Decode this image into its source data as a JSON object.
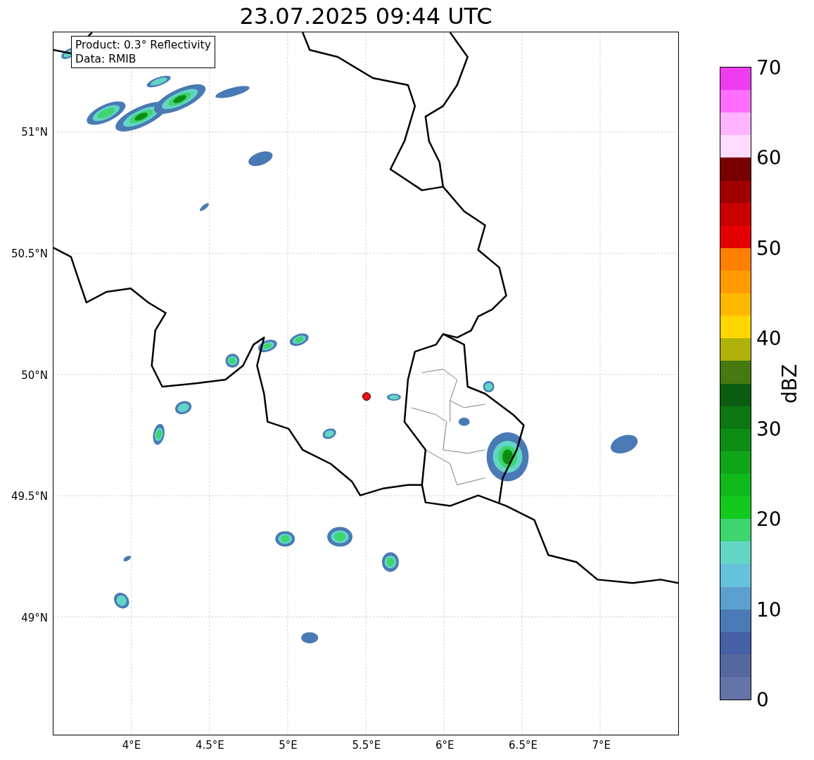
{
  "title": "23.07.2025 09:44 UTC",
  "legend": {
    "lines": [
      "Product: 0.3° Reflectivity",
      "Data: RMIB"
    ]
  },
  "x_ticks": [
    "4°E",
    "4.5°E",
    "5°E",
    "5.5°E",
    "6°E",
    "6.5°E",
    "7°E"
  ],
  "y_ticks": [
    "51°N",
    "50.5°N",
    "50°N",
    "49.5°N",
    "49°N"
  ],
  "colorbar": {
    "label": "dBZ",
    "ticks": [
      "70",
      "60",
      "50",
      "40",
      "30",
      "20",
      "10",
      "0"
    ],
    "bands": [
      {
        "color": "#f03cf0"
      },
      {
        "color": "#ff6eff"
      },
      {
        "color": "#ffb4ff"
      },
      {
        "color": "#ffdcff"
      },
      {
        "color": "#780000"
      },
      {
        "color": "#a00000"
      },
      {
        "color": "#c80000"
      },
      {
        "color": "#e40000"
      },
      {
        "color": "#ff7f00"
      },
      {
        "color": "#ff9b00"
      },
      {
        "color": "#ffb800"
      },
      {
        "color": "#ffd700"
      },
      {
        "color": "#afb20a"
      },
      {
        "color": "#46790f"
      },
      {
        "color": "#0a5c10"
      },
      {
        "color": "#0c7713"
      },
      {
        "color": "#0d8c14"
      },
      {
        "color": "#0fa518"
      },
      {
        "color": "#10b91a"
      },
      {
        "color": "#13c91e"
      },
      {
        "color": "#3ed46e"
      },
      {
        "color": "#63d5c5"
      },
      {
        "color": "#65c1dc"
      },
      {
        "color": "#5ba0cc"
      },
      {
        "color": "#4a7ab5"
      },
      {
        "color": "#4660a5"
      },
      {
        "color": "#55679f"
      },
      {
        "color": "#6474a8"
      }
    ]
  }
}
